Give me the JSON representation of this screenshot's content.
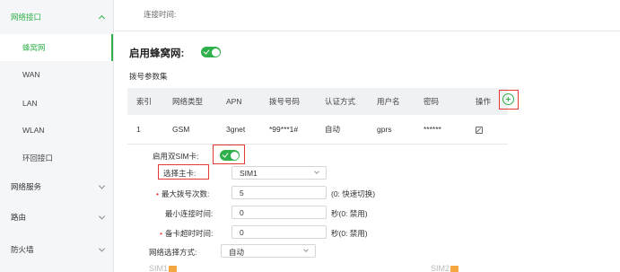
{
  "sidebar": {
    "items": [
      {
        "label": "网络接口",
        "type": "group",
        "expanded": true
      },
      {
        "label": "蜂窝网",
        "type": "sub",
        "active": true
      },
      {
        "label": "WAN",
        "type": "sub"
      },
      {
        "label": "LAN",
        "type": "sub"
      },
      {
        "label": "WLAN",
        "type": "sub"
      },
      {
        "label": "环回接口",
        "type": "sub"
      },
      {
        "label": "网络服务",
        "type": "group"
      },
      {
        "label": "路由",
        "type": "group"
      },
      {
        "label": "防火墙",
        "type": "group"
      }
    ]
  },
  "header": {
    "connection_time_label": "连接时间:"
  },
  "cellular": {
    "enable_label": "启用蜂窝网:",
    "enable_on": true,
    "dial_section_title": "拨号参数集",
    "table": {
      "columns": [
        "索引",
        "网络类型",
        "APN",
        "拨号号码",
        "认证方式",
        "用户名",
        "密码",
        "操作"
      ],
      "rows": [
        [
          "1",
          "GSM",
          "3gnet",
          "*99***1#",
          "自动",
          "gprs",
          "******",
          ""
        ]
      ]
    },
    "dual_sim_label": "启用双SIM卡:",
    "dual_sim_on": true,
    "main_card_label": "选择主卡:",
    "main_card_value": "SIM1",
    "max_dial_label": "最大拨号次数:",
    "max_dial_value": "5",
    "max_dial_hint": "(0: 快速切换)",
    "min_conn_label": "最小连接时间:",
    "min_conn_value": "0",
    "min_conn_hint": "秒(0: 禁用)",
    "backup_timeout_label": "备卡超时时间:",
    "backup_timeout_value": "0",
    "backup_timeout_hint": "秒(0: 禁用)",
    "network_mode_label": "网络选择方式:",
    "network_mode_value": "自动",
    "sim1_label": "SIM1",
    "sim2_label": "SIM2"
  },
  "colors": {
    "accent": "#2fb04b",
    "highlight": "#e53935"
  }
}
